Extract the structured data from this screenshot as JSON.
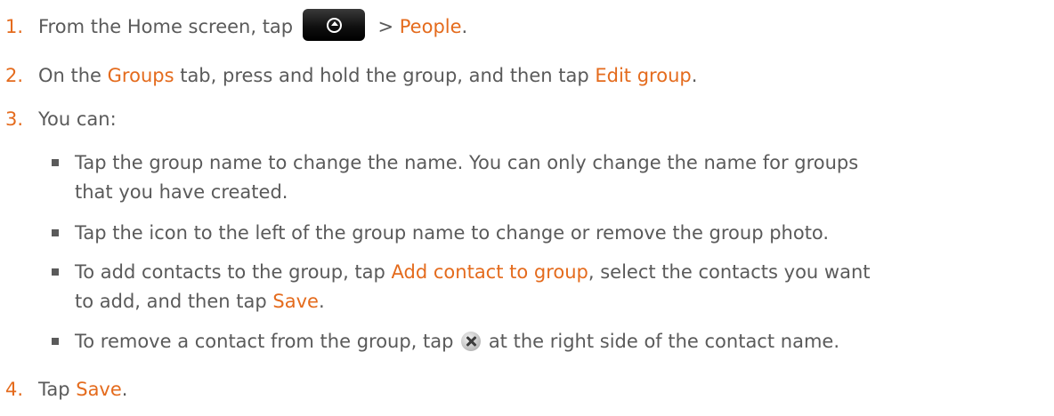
{
  "steps": [
    {
      "num": "1.",
      "pre": "From the Home screen, tap",
      "icon": "all-apps-icon",
      "mid": " > ",
      "people": "People",
      "post": "."
    },
    {
      "num": "2.",
      "pre": "On the ",
      "groups_tab": "Groups",
      "mid": " tab, press and hold the group, and then tap ",
      "edit_group": "Edit group",
      "post": "."
    },
    {
      "num": "3.",
      "text": "You can:"
    },
    {
      "num": "4.",
      "pre": "Tap ",
      "save": "Save",
      "post": "."
    }
  ],
  "bullets": [
    {
      "line1": "Tap the group name to change the name. You can only change the name for groups",
      "line2": "that you have created."
    },
    {
      "text": "Tap the icon to the left of the group name to change or remove the group photo."
    },
    {
      "pre": "To add contacts to the group, tap ",
      "add_contact": "Add contact to group",
      "mid": ", select the contacts you want",
      "line2_pre": "to add, and then tap ",
      "save": "Save",
      "post": "."
    },
    {
      "pre": "To remove a contact from the group, tap ",
      "icon": "remove-x-icon",
      "post": " at the right side of the contact name."
    }
  ],
  "colors": {
    "highlight": "#e46b1d",
    "body_text": "#5a5a5a"
  }
}
